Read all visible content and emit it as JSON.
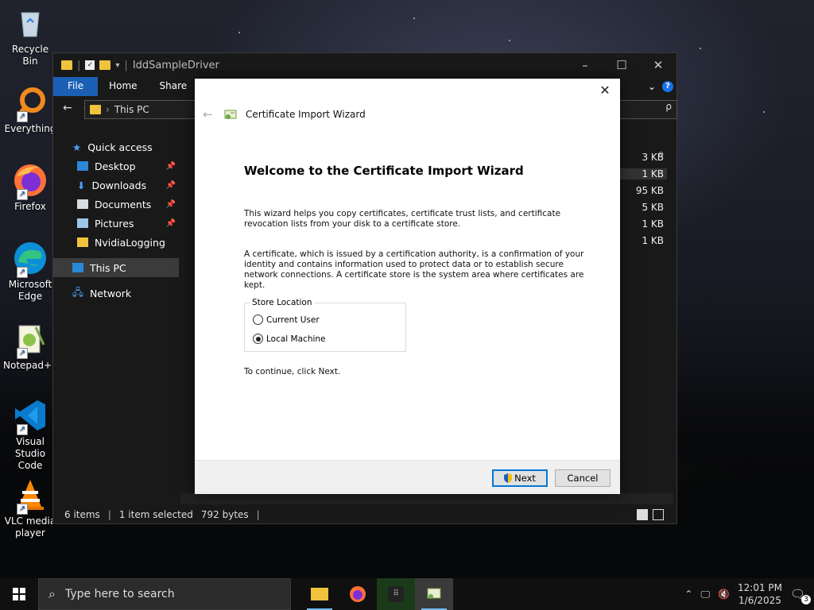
{
  "desktop": {
    "icons": [
      {
        "label": "Recycle Bin",
        "icon": "recycle-bin-icon"
      },
      {
        "label": "Everything",
        "icon": "everything-search-icon"
      },
      {
        "label": "Firefox",
        "icon": "firefox-icon"
      },
      {
        "label": "Microsoft Edge",
        "icon": "edge-icon"
      },
      {
        "label": "Notepad++",
        "icon": "notepadpp-icon"
      },
      {
        "label": "Visual Studio Code",
        "icon": "vscode-icon"
      },
      {
        "label": "VLC media player",
        "icon": "vlc-icon"
      }
    ]
  },
  "explorer": {
    "title": "IddSampleDriver",
    "ribbon_tabs": [
      "File",
      "Home",
      "Share"
    ],
    "address": "This PC",
    "search_hint": "ρ",
    "column_fragment": "e",
    "nav": [
      {
        "label": "Quick access"
      },
      {
        "label": "Desktop"
      },
      {
        "label": "Downloads"
      },
      {
        "label": "Documents"
      },
      {
        "label": "Pictures"
      },
      {
        "label": "NvidiaLogging"
      },
      {
        "label": "This PC"
      },
      {
        "label": "Network"
      }
    ],
    "file_sizes": [
      "3 KB",
      "1 KB",
      "95 KB",
      "5 KB",
      "1 KB",
      "1 KB"
    ],
    "status": {
      "items": "6 items",
      "selected": "1 item selected",
      "size": "792 bytes"
    }
  },
  "wizard": {
    "title": "Certificate Import Wizard",
    "heading": "Welcome to the Certificate Import Wizard",
    "para1": "This wizard helps you copy certificates, certificate trust lists, and certificate revocation lists from your disk to a certificate store.",
    "para2": "A certificate, which is issued by a certification authority, is a confirmation of your identity and contains information used to protect data or to establish secure network connections. A certificate store is the system area where certificates are kept.",
    "store_location_label": "Store Location",
    "options": [
      {
        "label": "Current User",
        "selected": false
      },
      {
        "label": "Local Machine",
        "selected": true
      }
    ],
    "continue_text": "To continue, click Next.",
    "next_label": "Next",
    "cancel_label": "Cancel"
  },
  "taskbar": {
    "search_placeholder": "Type here to search",
    "time": "12:01 PM",
    "date": "1/6/2025",
    "notification_count": "3"
  },
  "colors": {
    "accent": "#1a5fb4",
    "primary_border": "#0078d7"
  }
}
